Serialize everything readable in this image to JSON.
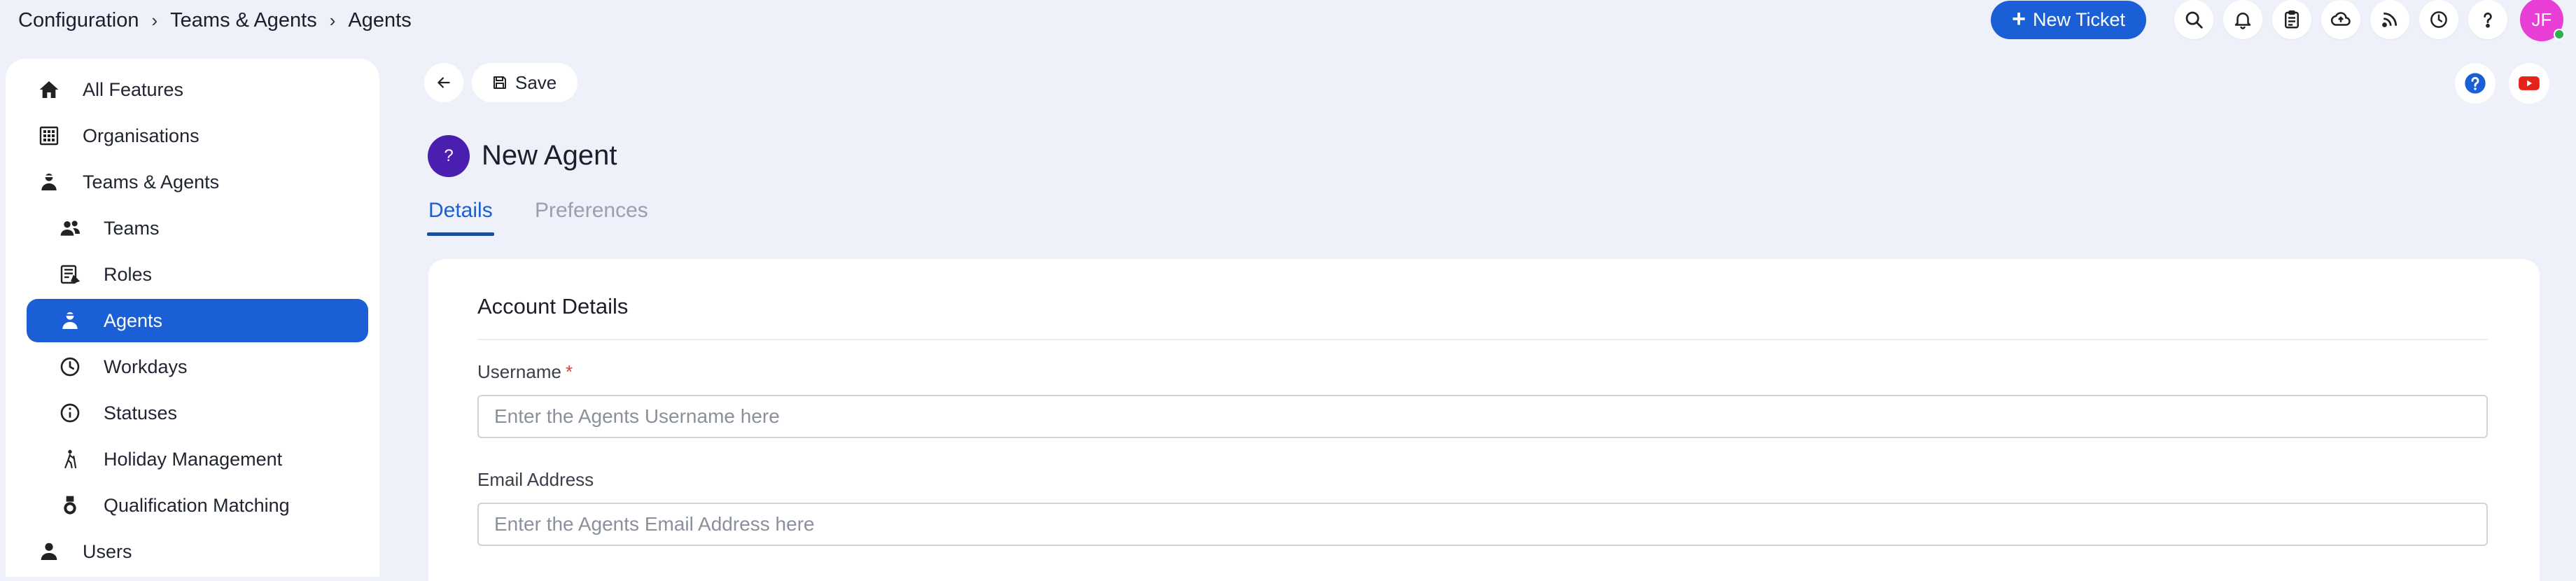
{
  "breadcrumb": [
    "Configuration",
    "Teams & Agents",
    "Agents"
  ],
  "header": {
    "new_ticket_label": "New Ticket",
    "icons": [
      "search-icon",
      "bell-icon",
      "clipboard-icon",
      "cloud-upload-icon",
      "rss-icon",
      "clock-icon",
      "question-icon"
    ],
    "avatar_initials": "JF",
    "avatar_color": "#e83ed6",
    "status_color": "#2bb24c"
  },
  "sidebar": {
    "items": [
      {
        "label": "All Features",
        "icon": "home-icon"
      },
      {
        "label": "Organisations",
        "icon": "building-icon"
      },
      {
        "label": "Teams & Agents",
        "icon": "agent-icon"
      },
      {
        "label": "Teams",
        "icon": "team-icon"
      },
      {
        "label": "Roles",
        "icon": "roles-icon"
      },
      {
        "label": "Agents",
        "icon": "agent-icon",
        "active": true
      },
      {
        "label": "Workdays",
        "icon": "clock-icon"
      },
      {
        "label": "Statuses",
        "icon": "info-icon"
      },
      {
        "label": "Holiday Management",
        "icon": "hiking-icon"
      },
      {
        "label": "Qualification Matching",
        "icon": "medal-icon"
      },
      {
        "label": "Users",
        "icon": "user-icon"
      }
    ]
  },
  "toolbar": {
    "save_label": "Save"
  },
  "page": {
    "avatar_text": "?",
    "title": "New Agent",
    "tabs": [
      {
        "label": "Details",
        "active": true
      },
      {
        "label": "Preferences",
        "active": false
      }
    ]
  },
  "form": {
    "section_title": "Account Details",
    "username_label": "Username",
    "username_required": "*",
    "username_placeholder": "Enter the Agents Username here",
    "email_label": "Email Address",
    "email_placeholder": "Enter the Agents Email Address here"
  },
  "colors": {
    "accent": "#1a5fd6",
    "background": "#eef0fa",
    "agent_avatar": "#4a1fb0",
    "youtube": "#e62117"
  }
}
